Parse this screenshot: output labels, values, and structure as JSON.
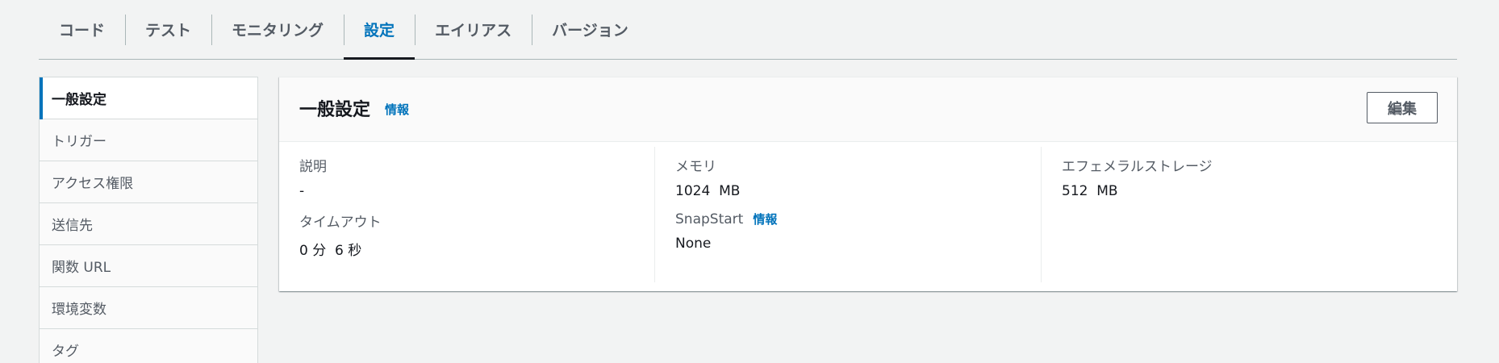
{
  "tabs": [
    {
      "label": "コード",
      "active": false
    },
    {
      "label": "テスト",
      "active": false
    },
    {
      "label": "モニタリング",
      "active": false
    },
    {
      "label": "設定",
      "active": true
    },
    {
      "label": "エイリアス",
      "active": false
    },
    {
      "label": "バージョン",
      "active": false
    }
  ],
  "sidenav": {
    "items": [
      {
        "label": "一般設定",
        "active": true
      },
      {
        "label": "トリガー",
        "active": false
      },
      {
        "label": "アクセス権限",
        "active": false
      },
      {
        "label": "送信先",
        "active": false
      },
      {
        "label": "関数 URL",
        "active": false
      },
      {
        "label": "環境変数",
        "active": false
      },
      {
        "label": "タグ",
        "active": false
      }
    ]
  },
  "panel": {
    "title": "一般設定",
    "info_label": "情報",
    "edit_label": "編集",
    "fields": {
      "description": {
        "label": "説明",
        "value": "-"
      },
      "timeout": {
        "label": "タイムアウト",
        "value": "0 分  6 秒"
      },
      "memory": {
        "label": "メモリ",
        "value": "1024  MB"
      },
      "snapstart": {
        "label": "SnapStart",
        "info": "情報",
        "value": "None"
      },
      "ephemeral_storage": {
        "label": "エフェメラルストレージ",
        "value": "512  MB"
      }
    }
  },
  "colors": {
    "background": "#f2f3f3",
    "accent": "#0073bb",
    "text": "#16191f",
    "muted_text": "#545b64",
    "border": "#d5dbdb"
  }
}
